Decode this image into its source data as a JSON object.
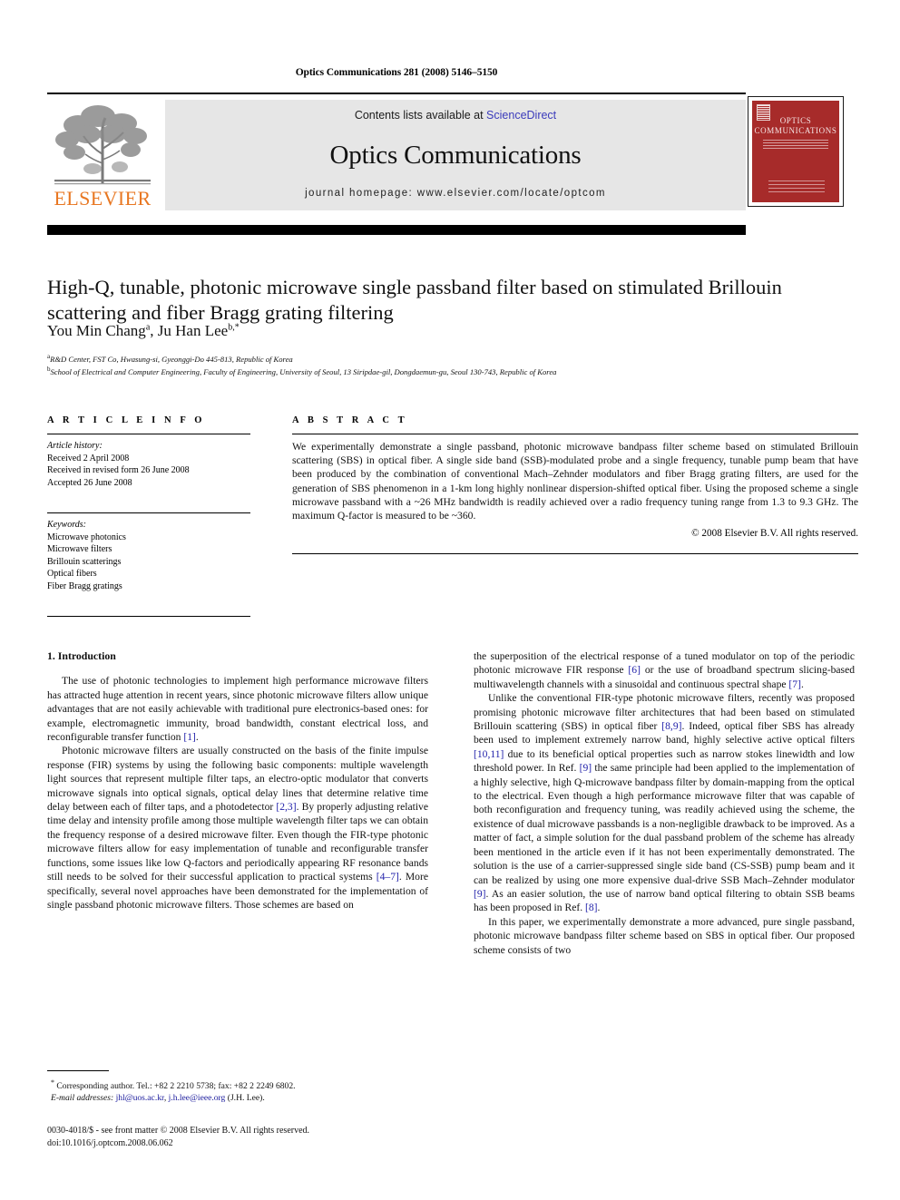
{
  "running_head": "Optics Communications 281 (2008) 5146–5150",
  "masthead": {
    "contents_prefix": "Contents lists available at ",
    "sciencedirect": "ScienceDirect",
    "journal_title": "Optics Communications",
    "homepage": "journal homepage: www.elsevier.com/locate/optcom",
    "publisher_wordmark": "ELSEVIER",
    "cover_title_line1": "OPTICS",
    "cover_title_line2": "COMMUNICATIONS",
    "accent_orange": "#E87722",
    "cover_red": "#A72B2A",
    "link_blue": "#3b3bbb"
  },
  "article": {
    "title": "High-Q, tunable, photonic microwave single passband filter based on stimulated Brillouin scattering and fiber Bragg grating filtering",
    "authors_plain": "You Min Chang a, Ju Han Lee b,*",
    "author_1": "You Min Chang",
    "author_1_mark": "a",
    "author_sep": ", ",
    "author_2": "Ju Han Lee",
    "author_2_mark": "b,*",
    "affiliation_a_mark": "a",
    "affiliation_a": "R&D Center, FST Co, Hwasung-si, Gyeonggi-Do 445-813, Republic of Korea",
    "affiliation_b_mark": "b",
    "affiliation_b": "School of Electrical and Computer Engineering, Faculty of Engineering, University of Seoul, 13 Siripdae-gil, Dongdaemun-gu, Seoul 130-743, Republic of Korea"
  },
  "info": {
    "heading": "A R T I C L E   I N F O",
    "history_label": "Article history:",
    "history": [
      "Received 2 April 2008",
      "Received in revised form 26 June 2008",
      "Accepted 26 June 2008"
    ],
    "keywords_label": "Keywords:",
    "keywords": [
      "Microwave photonics",
      "Microwave filters",
      "Brillouin scatterings",
      "Optical fibers",
      "Fiber Bragg gratings"
    ]
  },
  "abstract": {
    "heading": "A B S T R A C T",
    "text": "We experimentally demonstrate a single passband, photonic microwave bandpass filter scheme based on stimulated Brillouin scattering (SBS) in optical fiber. A single side band (SSB)-modulated probe and a single frequency, tunable pump beam that have been produced by the combination of conventional Mach–Zehnder modulators and fiber Bragg grating filters, are used for the generation of SBS phenomenon in a 1-km long highly nonlinear dispersion-shifted optical fiber. Using the proposed scheme a single microwave passband with a ~26 MHz bandwidth is readily achieved over a radio frequency tuning range from 1.3 to 9.3 GHz. The maximum Q-factor is measured to be ~360.",
    "copyright": "© 2008 Elsevier B.V. All rights reserved."
  },
  "body": {
    "section_heading": "1. Introduction",
    "left_paragraphs": [
      "The use of photonic technologies to implement high performance microwave filters has attracted huge attention in recent years, since photonic microwave filters allow unique advantages that are not easily achievable with traditional pure electronics-based ones: for example, electromagnetic immunity, broad bandwidth, constant electrical loss, and reconfigurable transfer function [1].",
      "Photonic microwave filters are usually constructed on the basis of the finite impulse response (FIR) systems by using the following basic components: multiple wavelength light sources that represent multiple filter taps, an electro-optic modulator that converts microwave signals into optical signals, optical delay lines that determine relative time delay between each of filter taps, and a photodetector [2,3]. By properly adjusting relative time delay and intensity profile among those multiple wavelength filter taps we can obtain the frequency response of a desired microwave filter. Even though the FIR-type photonic microwave filters allow for easy implementation of tunable and reconfigurable transfer functions, some issues like low Q-factors and periodically appearing RF resonance bands still needs to be solved for their successful application to practical systems [4–7]. More specifically, several novel approaches have been demonstrated for the implementation of single passband photonic microwave filters. Those schemes are based on"
    ],
    "right_paragraphs": [
      "the superposition of the electrical response of a tuned modulator on top of the periodic photonic microwave FIR response [6] or the use of broadband spectrum slicing-based multiwavelength channels with a sinusoidal and continuous spectral shape [7].",
      "Unlike the conventional FIR-type photonic microwave filters, recently was proposed promising photonic microwave filter architectures that had been based on stimulated Brillouin scattering (SBS) in optical fiber [8,9]. Indeed, optical fiber SBS has already been used to implement extremely narrow band, highly selective active optical filters [10,11] due to its beneficial optical properties such as narrow stokes linewidth and low threshold power. In Ref. [9] the same principle had been applied to the implementation of a highly selective, high Q-microwave bandpass filter by domain-mapping from the optical to the electrical. Even though a high performance microwave filter that was capable of both reconfiguration and frequency tuning, was readily achieved using the scheme, the existence of dual microwave passbands is a non-negligible drawback to be improved. As a matter of fact, a simple solution for the dual passband problem of the scheme has already been mentioned in the article even if it has not been experimentally demonstrated. The solution is the use of a carrier-suppressed single side band (CS-SSB) pump beam and it can be realized by using one more expensive dual-drive SSB Mach–Zehnder modulator [9]. As an easier solution, the use of narrow band optical filtering to obtain SSB beams has been proposed in Ref. [8].",
      "In this paper, we experimentally demonstrate a more advanced, pure single passband, photonic microwave bandpass filter scheme based on SBS in optical fiber. Our proposed scheme consists of two"
    ]
  },
  "footnote": {
    "marker": "*",
    "corresponding": "Corresponding author. Tel.: +82 2 2210 5738; fax: +82 2 2249 6802.",
    "email_label": "E-mail addresses:",
    "email_1": "jhl@uos.ac.kr",
    "email_sep": ", ",
    "email_2": "j.h.lee@ieee.org",
    "email_suffix": " (J.H. Lee)."
  },
  "imprint": {
    "line1": "0030-4018/$ - see front matter © 2008 Elsevier B.V. All rights reserved.",
    "line2": "doi:10.1016/j.optcom.2008.06.062"
  }
}
